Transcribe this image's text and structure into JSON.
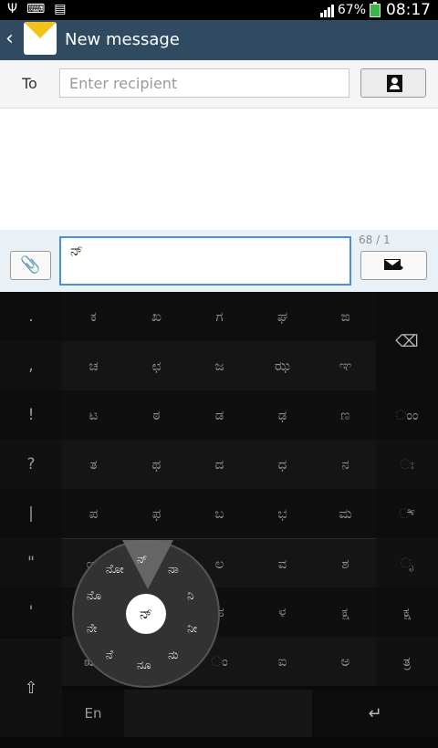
{
  "status_bar": {
    "battery": "67%",
    "time": "08:17"
  },
  "action_bar": {
    "title": "New message"
  },
  "recipient": {
    "label": "To",
    "placeholder": "Enter recipient"
  },
  "compose": {
    "text": "ನ್",
    "counter": "68 / 1"
  },
  "keyboard": {
    "left_column": [
      ".",
      ",",
      "!",
      "?",
      "|",
      "\"",
      "'"
    ],
    "grid_rows": [
      [
        "ಕ",
        "ಖ",
        "ಗ",
        "ಘ",
        "ಙ"
      ],
      [
        "ಚ",
        "ಛ",
        "ಜ",
        "ಝ",
        "ಞ"
      ],
      [
        "ಟ",
        "ಠ",
        "ಡ",
        "ಢ",
        "ಣ"
      ],
      [
        "ತ",
        "ಥ",
        "ದ",
        "ಧ",
        "ನ"
      ],
      [
        "ಪ",
        "ಫ",
        "ಬ",
        "ಭ",
        "ಮ"
      ],
      [
        "ಯ",
        "ರ",
        "ಲ",
        "ವ",
        "ಶ"
      ],
      [
        "ಷ",
        "ಸ",
        "ಹ",
        "ಳ",
        "ಕ್ಷ"
      ],
      [
        "ೠ",
        "ಌ",
        "ಂ",
        "ಐ",
        "ಅ"
      ]
    ],
    "right_column": [
      "ಂಂ",
      "ಃ",
      "ೆ್",
      "ೃ",
      "ಕ್ಷ",
      "ತ್ರ"
    ],
    "radial": {
      "center": "ನ್",
      "items": [
        "ನ್",
        "ನಾ",
        "ನಿ",
        "ನೀ",
        "ನು",
        "ನೂ",
        "ನೆ",
        "ನೇ",
        "ನೊ",
        "ನೋ"
      ]
    },
    "lang_key": "En"
  }
}
